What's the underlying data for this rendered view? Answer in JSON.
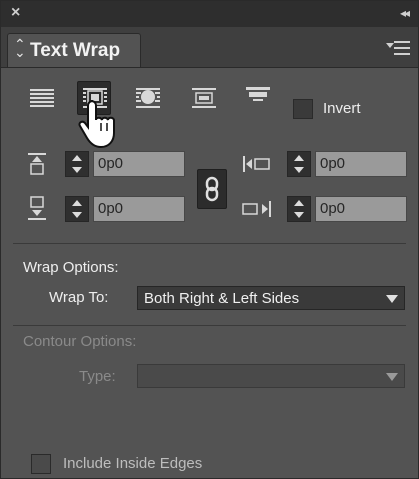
{
  "panel": {
    "tab_title": "Text Wrap",
    "close_glyph": "×",
    "collapse_glyph": "◂◂"
  },
  "wrap_modes": [
    {
      "name": "no-text-wrap",
      "icon": "no-wrap-icon",
      "selected": false
    },
    {
      "name": "wrap-around-bounding-box",
      "icon": "bounding-box-wrap-icon",
      "selected": true
    },
    {
      "name": "wrap-around-object-shape",
      "icon": "object-shape-wrap-icon",
      "selected": false
    },
    {
      "name": "jump-object",
      "icon": "jump-object-icon",
      "selected": false
    },
    {
      "name": "jump-to-next-column",
      "icon": "jump-to-next-column-icon",
      "selected": false
    }
  ],
  "invert": {
    "label": "Invert",
    "checked": false
  },
  "offsets": {
    "top": "0p0",
    "bottom": "0p0",
    "left": "0p0",
    "right": "0p0"
  },
  "wrap_options": {
    "heading": "Wrap Options:",
    "wrap_to_label": "Wrap To:",
    "wrap_to_value": "Both Right & Left Sides"
  },
  "contour_options": {
    "heading": "Contour Options:",
    "type_label": "Type:",
    "type_value": ""
  },
  "include_inside_edges": {
    "label": "Include Inside Edges",
    "checked": false
  },
  "colors": {
    "panel_bg": "#535353",
    "field_bg": "#9a9a9a",
    "dark_chrome": "#2e2e2e"
  }
}
